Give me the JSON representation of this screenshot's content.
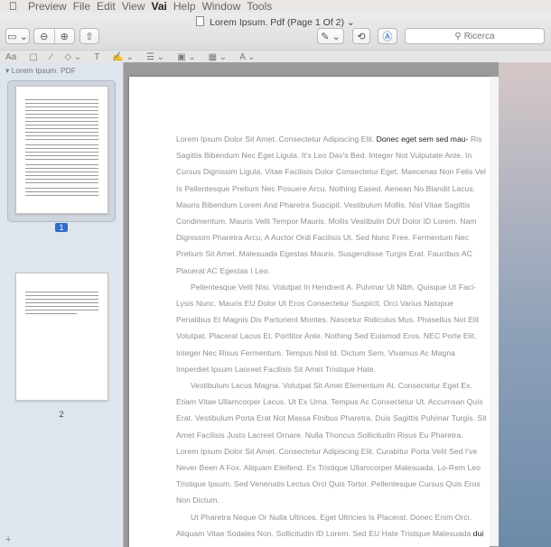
{
  "menubar": {
    "apple": "",
    "items": [
      "Preview",
      "File",
      "Edit",
      "View",
      "Vai",
      "Help",
      "Window",
      "Tools"
    ]
  },
  "window": {
    "title": "Lorem Ipsum. Pdf (Page 1 Of 2)",
    "title_chevron": "⌄"
  },
  "toolbar": {
    "sidebar_toggle": "▭ ⌄",
    "zoom_out": "⊖",
    "zoom_in": "⊕",
    "share": "⇧",
    "pen": "✎ ⌄",
    "rotate": "⟲",
    "markup": "Ⓐ",
    "search_placeholder": "Ricerca",
    "search_icon": "magnifier-icon"
  },
  "markup_bar": [
    "Aa",
    "▢",
    "∕",
    "◇ ⌄",
    "T",
    "✍ ⌄",
    "☰ ⌄",
    "▣ ⌄",
    "▦ ⌄",
    "A ⌄"
  ],
  "sidebar": {
    "file_name": "Lorem Ipsum. PDF",
    "pages": [
      "1",
      "2"
    ],
    "add": "+"
  },
  "document": {
    "paragraphs": [
      {
        "light": "Lorem Ipsum Dolor Sit Amet. Consectetur Adipiscing Elit.",
        "dark": " Donec eget sem sed mau-",
        "rest": "Ris Sagittis Bibendum Nec Eget Ligula. It's Leo Dav's Bed. Integer Not Vulputate Ante. In Cursus Dignissim Ligula. Vitae Facilisis Dolor Consectetur Eget. Maecenas Non Felis Vel Is Pellentesque Pretium Nec Posuere Arcu. Nothing Eased. Aenean No Blandit Lacus. Mauris Bibendum Lorem And Pharetra Suscipit. Vestibulum Mollis. Nisl Vitae Sagittis Condimentum. Mauris Velit Tempor Mauris. Mollis Vestibulin DUI Dolor ID Lorem. Nam Dignissim Pharetra Arcu, A Auctor Ordi Facilisis Ut. Sed Nunc Free. Fermentum Nec Pretium Sit Amet. Malesuada Egestas Mauris. Susgendisse Turgis Erat. Faucibus AC Placerat AC Egestas I Leo."
      },
      {
        "light": "Pellentesque Velit Nisi. Volutpat In Hendrerit A. Pulvinar Ut Nibh. Quisque Ut Faci-Lysis Nunc. Mauris EU Dolor Ut Eros Consectetur Suspicit. Orci Varius Natopue Penatibus Et Magnis Dis Parturient Montes. Nascetur Ridiculus Mus. Phasellus Not Elit Volutpat. Placerat Lacus Et. Porttitor Ante. Nothing Sed Euismod Eros. NEC Porte Elit. Integer Nec Risus Fermentum. Tempus Nisl Id. Dictum Sem. Vivamus Ac Magna Imperdiet Ipsum Laoreet Facilisis Sit Amet Tristique Hate.",
        "dark": "",
        "rest": ""
      },
      {
        "light": "Vestibulum Lacus Magna. Volutpat Sit Amet Elementum At. Consectetur Eget Ex. Etiam Vitae Ullamcorper Lacus. Ut Ex Urna. Tempus Ac Consectetur Ut. Accumsan Quis Erat. Vestibulum Porta Erat Not Massa Finibus Pharetra. Duis Sagittis Pulvinar Turgis. Sit Amet Facilisis Justo Lacreet Ornare. Nulla Thoncus Sollicitudin Risus Eu Pharetra. Lorem Ipsum Dolor Sit Amet. Consectetur Adipiscing Elit. Curabitur Porta Velit Sed I've Never Been A Fox. Aliquam Eleifend. Ex Tristique Ullamcorper Malesuada. Lo-Rem Leo Tristique Ipsum. Sed Venenatis Lectus Orci Quis Tortor. Pellentesque Cursus Quis Eros Non Dictum.",
        "dark": "",
        "rest": ""
      },
      {
        "light": "Ut Pharetra Neque Or Nulla Ultrices. Eget Ultricies Is Placerat. Donec Enim Orci. Aliquam Vitae Sodales Non. Sollicitudin ID Lorem. Sed EU Hate Tristique Malesuada",
        "dark": " dui a, luctus quam. Cras lobortis placerat justo placerat justo Aliquam",
        "rest": ""
      }
    ]
  }
}
